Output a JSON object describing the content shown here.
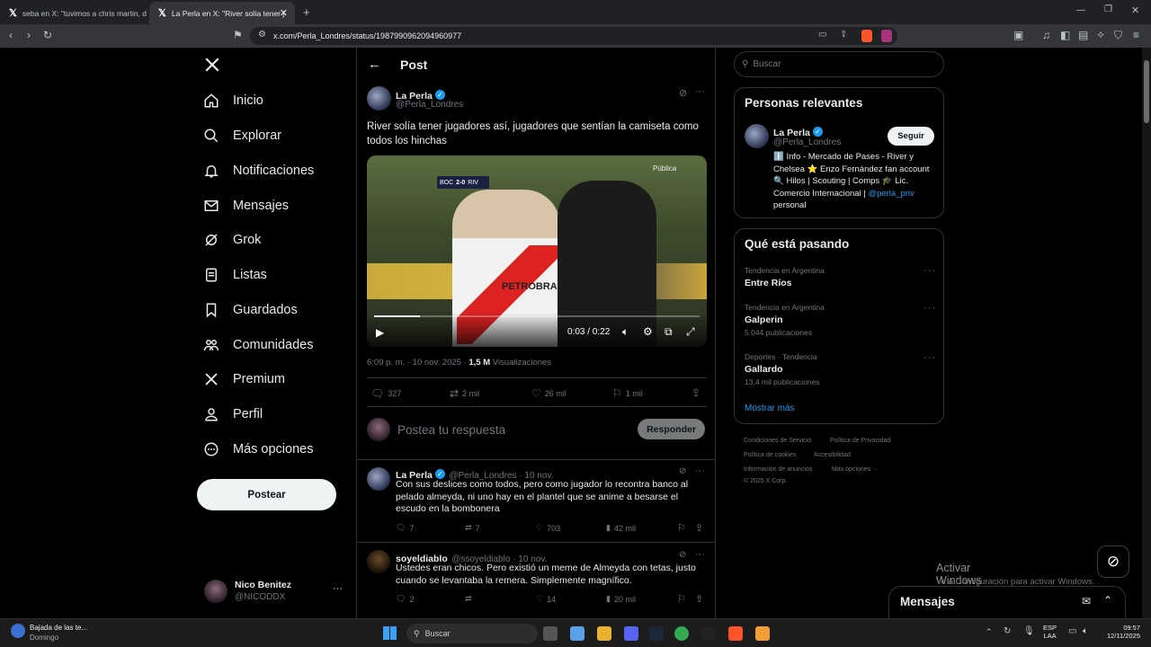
{
  "browser": {
    "tabs": [
      {
        "label": "seba en X: \"tuvimos a chris martin, d",
        "active": false
      },
      {
        "label": "La Perla en X: \"River solía tener j",
        "active": true
      }
    ],
    "url": "x.com/Perla_Londres/status/1987990962094960977"
  },
  "sidebar": {
    "items": [
      {
        "label": "Inicio",
        "icon": "home-icon"
      },
      {
        "label": "Explorar",
        "icon": "search-icon"
      },
      {
        "label": "Notificaciones",
        "icon": "bell-icon"
      },
      {
        "label": "Mensajes",
        "icon": "mail-icon"
      },
      {
        "label": "Grok",
        "icon": "grok-icon"
      },
      {
        "label": "Listas",
        "icon": "list-icon"
      },
      {
        "label": "Guardados",
        "icon": "bookmark-icon"
      },
      {
        "label": "Comunidades",
        "icon": "communities-icon"
      },
      {
        "label": "Premium",
        "icon": "x-logo-icon"
      },
      {
        "label": "Perfil",
        "icon": "person-icon"
      },
      {
        "label": "Más opciones",
        "icon": "more-circle-icon"
      }
    ],
    "post_button": "Postear",
    "account": {
      "name": "Nico Benitez",
      "handle": "@NICODDX"
    }
  },
  "main": {
    "header": "Post",
    "post": {
      "author": "La Perla",
      "handle": "@Perla_Londres",
      "text": "River solía tener jugadores así, jugadores que sentían la camiseta como todos los hinchas",
      "video": {
        "time": "0:03 / 0:22",
        "score_home": "BOC",
        "score": "2-0",
        "score_away": "RIV",
        "shirt_text": "PETROBRAS",
        "watermark": "Pública"
      },
      "timestamp": "6:09 p. m. · 10 nov. 2025 · ",
      "views": "1,5 M",
      "views_label": "Visualizaciones",
      "replies": "327",
      "reposts": "2 mil",
      "likes": "26 mil",
      "bookmarks": "1 mil"
    },
    "reply_box": {
      "placeholder": "Postea tu respuesta",
      "button": "Responder"
    },
    "replies": [
      {
        "author": "La Perla",
        "handle": "@Perla_Londres · 10 nov.",
        "text": "Con sus deslices como todos, pero como jugador lo recontra banco al pelado almeyda, ni uno hay en el plantel que se anime a besarse el escudo en la bombonera",
        "replies": "7",
        "reposts": "7",
        "likes": "703",
        "views": "42 mil"
      },
      {
        "author": "soyeldiablo",
        "handle": "@ssoyeldiablo · 10 nov.",
        "text": "Ustedes eran chicos. Pero existió un meme de Almeyda con tetas, justo cuando se levantaba la remera. Simplemente magnífico.",
        "replies": "2",
        "reposts": "",
        "likes": "14",
        "views": "20 mil"
      }
    ]
  },
  "right": {
    "search_placeholder": "Buscar",
    "relevant": {
      "title": "Personas relevantes",
      "name": "La Perla",
      "handle": "@Perla_Londres",
      "follow": "Seguir",
      "bio": "ℹ️ Info - Mercado de Pases - River y Chelsea ⭐ Enzo Fernández fan account 🔍 Hilos | Scouting | Comps 🎓 Lic. Comercio Internacional | ",
      "bio_link": "@perla_priv",
      "bio_end": " personal"
    },
    "trends": {
      "title": "Qué está pasando",
      "items": [
        {
          "meta": "Tendencia en Argentina",
          "name": "Entre Ríos",
          "count": ""
        },
        {
          "meta": "Tendencia en Argentina",
          "name": "Galperin",
          "count": "5.044 publicaciones"
        },
        {
          "meta": "Deportes · Tendencia",
          "name": "Gallardo",
          "count": "13,4 mil publicaciones"
        }
      ],
      "more": "Mostrar más"
    },
    "footer": [
      "Condiciones de Servicio",
      "Política de Privacidad",
      "Política de cookies",
      "Accesibilidad",
      "Información de anuncios",
      "Más opciones ···",
      "© 2025 X Corp."
    ],
    "watermark_title": "Activar Windows",
    "watermark_sub": "Ve a Configuración para activar Windows.",
    "messages_label": "Mensajes"
  },
  "taskbar": {
    "news_title": "Bajada de las te...",
    "news_sub": "Domingo",
    "search": "Buscar",
    "lang": "ESP",
    "lang_sub": "LAA",
    "time": "09:57",
    "date": "12/11/2025"
  },
  "colors": {
    "accent": "#1d9bf0",
    "background": "#000000",
    "muted": "#71767b"
  }
}
